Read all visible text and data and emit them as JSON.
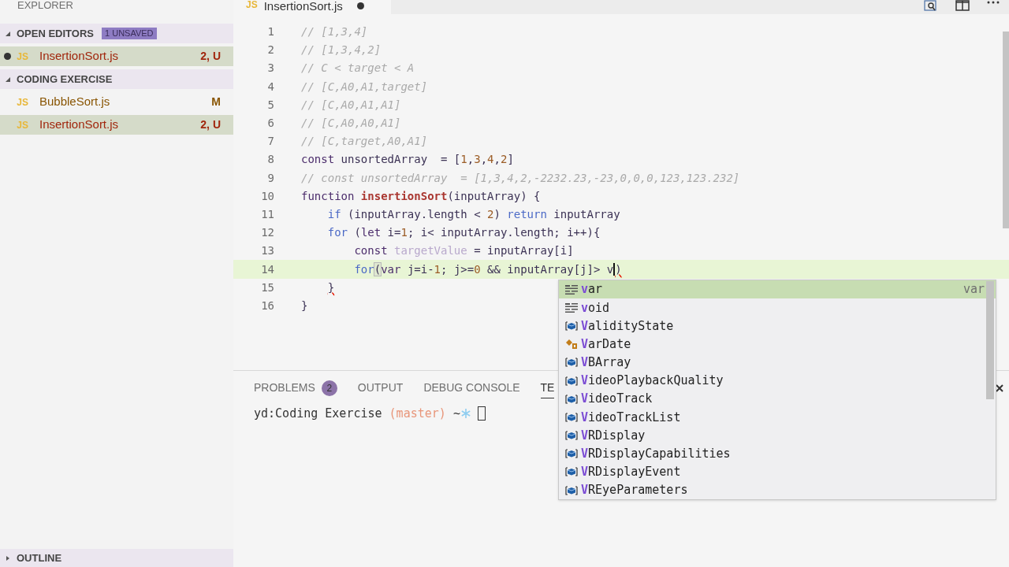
{
  "sidebar": {
    "title": "EXPLORER",
    "sections": [
      {
        "title": "OPEN EDITORS",
        "badge": "1 UNSAVED",
        "expanded": true,
        "items": [
          {
            "icon": "JS",
            "name": "InsertionSort.js",
            "status": "2, U",
            "color": "#a1260d",
            "dirty": true,
            "selected": true
          }
        ]
      },
      {
        "title": "CODING EXERCISE",
        "expanded": true,
        "items": [
          {
            "icon": "JS",
            "name": "BubbleSort.js",
            "status": "M",
            "color": "#895503",
            "dirty": false,
            "selected": false
          },
          {
            "icon": "JS",
            "name": "InsertionSort.js",
            "status": "2, U",
            "color": "#a1260d",
            "dirty": false,
            "selected": true
          }
        ]
      }
    ],
    "outline": {
      "title": "OUTLINE",
      "expanded": false
    }
  },
  "tab": {
    "icon": "JS",
    "title": "InsertionSort.js",
    "dirty": true
  },
  "editor": {
    "lines": [
      {
        "number": "1",
        "highlighted": false,
        "tokens": [
          {
            "kind": "comment",
            "text": "// [1,3,4]"
          }
        ]
      },
      {
        "number": "2",
        "highlighted": false,
        "tokens": [
          {
            "kind": "comment",
            "text": "// [1,3,4,2]"
          }
        ]
      },
      {
        "number": "3",
        "highlighted": false,
        "tokens": [
          {
            "kind": "comment",
            "text": "// C < target < A"
          }
        ]
      },
      {
        "number": "4",
        "highlighted": false,
        "tokens": [
          {
            "kind": "comment",
            "text": "// [C,A0,A1,target]"
          }
        ]
      },
      {
        "number": "5",
        "highlighted": false,
        "tokens": [
          {
            "kind": "comment",
            "text": "// [C,A0,A1,A1]"
          }
        ]
      },
      {
        "number": "6",
        "highlighted": false,
        "tokens": [
          {
            "kind": "comment",
            "text": "// [C,A0,A0,A1]"
          }
        ]
      },
      {
        "number": "7",
        "highlighted": false,
        "tokens": [
          {
            "kind": "comment",
            "text": "// [C,target,A0,A1]"
          }
        ]
      },
      {
        "number": "8",
        "highlighted": false,
        "tokens": [
          {
            "kind": "storage",
            "text": "const"
          },
          {
            "kind": "plain",
            "text": " unsortedArray  = ["
          },
          {
            "kind": "number",
            "text": "1"
          },
          {
            "kind": "plain",
            "text": ","
          },
          {
            "kind": "number",
            "text": "3"
          },
          {
            "kind": "plain",
            "text": ","
          },
          {
            "kind": "number",
            "text": "4"
          },
          {
            "kind": "plain",
            "text": ","
          },
          {
            "kind": "number",
            "text": "2"
          },
          {
            "kind": "plain",
            "text": "]"
          }
        ]
      },
      {
        "number": "9",
        "highlighted": false,
        "tokens": [
          {
            "kind": "comment",
            "text": "// const unsortedArray  = [1,3,4,2,-2232.23,-23,0,0,0,123,123.232]"
          }
        ]
      },
      {
        "number": "10",
        "highlighted": false,
        "tokens": [
          {
            "kind": "storage",
            "text": "function "
          },
          {
            "kind": "funcname",
            "text": "insertionSort"
          },
          {
            "kind": "plain",
            "text": "(inputArray) {"
          }
        ]
      },
      {
        "number": "11",
        "highlighted": false,
        "tokens": [
          {
            "kind": "keyword",
            "text": "    if"
          },
          {
            "kind": "plain",
            "text": " (inputArray.length < "
          },
          {
            "kind": "number",
            "text": "2"
          },
          {
            "kind": "plain",
            "text": ") "
          },
          {
            "kind": "keyword",
            "text": "return"
          },
          {
            "kind": "plain",
            "text": " inputArray"
          }
        ]
      },
      {
        "number": "12",
        "highlighted": false,
        "tokens": [
          {
            "kind": "keyword",
            "text": "    for"
          },
          {
            "kind": "plain",
            "text": " ("
          },
          {
            "kind": "storage",
            "text": "let"
          },
          {
            "kind": "plain",
            "text": " i="
          },
          {
            "kind": "number",
            "text": "1"
          },
          {
            "kind": "plain",
            "text": "; i< inputArray.length; i++){"
          }
        ]
      },
      {
        "number": "13",
        "highlighted": false,
        "tokens": [
          {
            "kind": "storage",
            "text": "        const "
          },
          {
            "kind": "unused",
            "text": "targetValue"
          },
          {
            "kind": "plain",
            "text": " = inputArray[i]"
          }
        ]
      },
      {
        "number": "14",
        "highlighted": true,
        "tokens": [
          {
            "kind": "keyword",
            "text": "        for"
          },
          {
            "kind": "bracket",
            "text": "("
          },
          {
            "kind": "storage",
            "text": "var"
          },
          {
            "kind": "plain",
            "text": " j=i-"
          },
          {
            "kind": "number",
            "text": "1"
          },
          {
            "kind": "plain",
            "text": "; j>="
          },
          {
            "kind": "number",
            "text": "0"
          },
          {
            "kind": "plain",
            "text": " && inputArray[j]> "
          },
          {
            "kind": "cursor",
            "text": "v"
          },
          {
            "kind": "error",
            "text": ")"
          }
        ]
      },
      {
        "number": "15",
        "highlighted": false,
        "tokens": [
          {
            "kind": "error",
            "text": "    }"
          }
        ]
      },
      {
        "number": "16",
        "highlighted": false,
        "tokens": [
          {
            "kind": "plain",
            "text": "}"
          }
        ]
      }
    ]
  },
  "suggestions": [
    {
      "kind": "keyword",
      "label": "var",
      "detail": "var",
      "selected": true
    },
    {
      "kind": "keyword",
      "label": "void",
      "selected": false
    },
    {
      "kind": "class",
      "label": "ValidityState",
      "selected": false
    },
    {
      "kind": "interface",
      "label": "VarDate",
      "selected": false
    },
    {
      "kind": "class",
      "label": "VBArray",
      "selected": false
    },
    {
      "kind": "class",
      "label": "VideoPlaybackQuality",
      "selected": false
    },
    {
      "kind": "class",
      "label": "VideoTrack",
      "selected": false
    },
    {
      "kind": "class",
      "label": "VideoTrackList",
      "selected": false
    },
    {
      "kind": "class",
      "label": "VRDisplay",
      "selected": false
    },
    {
      "kind": "class",
      "label": "VRDisplayCapabilities",
      "selected": false
    },
    {
      "kind": "class",
      "label": "VRDisplayEvent",
      "selected": false
    },
    {
      "kind": "class",
      "label": "VREyeParameters",
      "selected": false
    }
  ],
  "panel": {
    "tabs": [
      {
        "label": "PROBLEMS",
        "badge": "2",
        "selected": false
      },
      {
        "label": "OUTPUT",
        "selected": false
      },
      {
        "label": "DEBUG CONSOLE",
        "selected": false
      },
      {
        "label": "TE",
        "selected": true
      }
    ],
    "terminal": {
      "prompt": "yd:Coding Exercise ",
      "branch": "(master)",
      "tilde": "~"
    }
  }
}
